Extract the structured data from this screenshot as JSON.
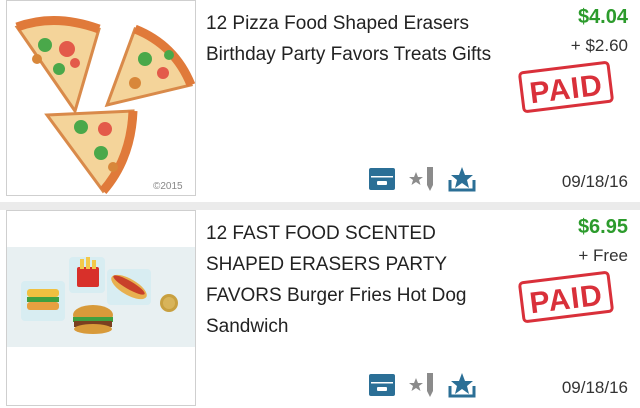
{
  "orders": [
    {
      "title": "12 Pizza Food Shaped Erasers Birthday Party Favors Treats Gifts",
      "price": "$4.04",
      "shipping": "+ $2.60",
      "status": "PAID",
      "date": "09/18/16",
      "image_watermark": "©2015",
      "icons": [
        "shipping-box-icon",
        "rate-pencil-icon",
        "feedback-star-icon"
      ]
    },
    {
      "title": "12 FAST FOOD SCENTED SHAPED ERASERS PARTY FAVORS Burger Fries Hot Dog Sandwich",
      "price": "$6.95",
      "shipping": "+ Free",
      "status": "PAID",
      "date": "09/18/16",
      "icons": [
        "shipping-box-icon",
        "rate-pencil-icon",
        "feedback-star-icon"
      ]
    }
  ],
  "colors": {
    "price": "#2c9b2c",
    "stamp": "#d9303a",
    "icon": "#2b6f96"
  }
}
